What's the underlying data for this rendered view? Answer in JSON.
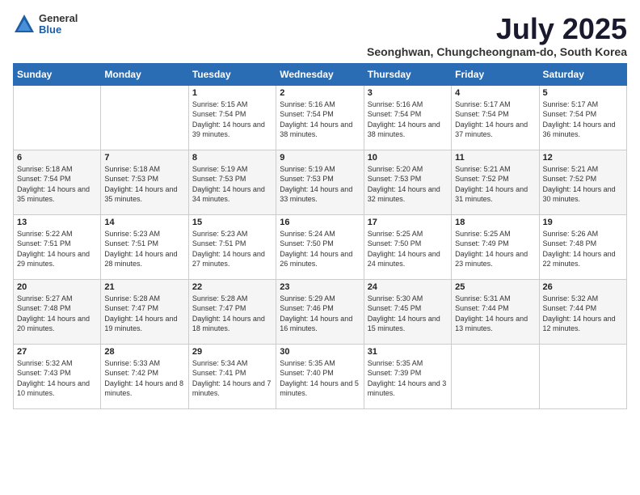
{
  "logo": {
    "general": "General",
    "blue": "Blue"
  },
  "title": "July 2025",
  "location": "Seonghwan, Chungcheongnam-do, South Korea",
  "weekdays": [
    "Sunday",
    "Monday",
    "Tuesday",
    "Wednesday",
    "Thursday",
    "Friday",
    "Saturday"
  ],
  "weeks": [
    [
      {
        "day": "",
        "info": ""
      },
      {
        "day": "",
        "info": ""
      },
      {
        "day": "1",
        "info": "Sunrise: 5:15 AM\nSunset: 7:54 PM\nDaylight: 14 hours and 39 minutes."
      },
      {
        "day": "2",
        "info": "Sunrise: 5:16 AM\nSunset: 7:54 PM\nDaylight: 14 hours and 38 minutes."
      },
      {
        "day": "3",
        "info": "Sunrise: 5:16 AM\nSunset: 7:54 PM\nDaylight: 14 hours and 38 minutes."
      },
      {
        "day": "4",
        "info": "Sunrise: 5:17 AM\nSunset: 7:54 PM\nDaylight: 14 hours and 37 minutes."
      },
      {
        "day": "5",
        "info": "Sunrise: 5:17 AM\nSunset: 7:54 PM\nDaylight: 14 hours and 36 minutes."
      }
    ],
    [
      {
        "day": "6",
        "info": "Sunrise: 5:18 AM\nSunset: 7:54 PM\nDaylight: 14 hours and 35 minutes."
      },
      {
        "day": "7",
        "info": "Sunrise: 5:18 AM\nSunset: 7:53 PM\nDaylight: 14 hours and 35 minutes."
      },
      {
        "day": "8",
        "info": "Sunrise: 5:19 AM\nSunset: 7:53 PM\nDaylight: 14 hours and 34 minutes."
      },
      {
        "day": "9",
        "info": "Sunrise: 5:19 AM\nSunset: 7:53 PM\nDaylight: 14 hours and 33 minutes."
      },
      {
        "day": "10",
        "info": "Sunrise: 5:20 AM\nSunset: 7:53 PM\nDaylight: 14 hours and 32 minutes."
      },
      {
        "day": "11",
        "info": "Sunrise: 5:21 AM\nSunset: 7:52 PM\nDaylight: 14 hours and 31 minutes."
      },
      {
        "day": "12",
        "info": "Sunrise: 5:21 AM\nSunset: 7:52 PM\nDaylight: 14 hours and 30 minutes."
      }
    ],
    [
      {
        "day": "13",
        "info": "Sunrise: 5:22 AM\nSunset: 7:51 PM\nDaylight: 14 hours and 29 minutes."
      },
      {
        "day": "14",
        "info": "Sunrise: 5:23 AM\nSunset: 7:51 PM\nDaylight: 14 hours and 28 minutes."
      },
      {
        "day": "15",
        "info": "Sunrise: 5:23 AM\nSunset: 7:51 PM\nDaylight: 14 hours and 27 minutes."
      },
      {
        "day": "16",
        "info": "Sunrise: 5:24 AM\nSunset: 7:50 PM\nDaylight: 14 hours and 26 minutes."
      },
      {
        "day": "17",
        "info": "Sunrise: 5:25 AM\nSunset: 7:50 PM\nDaylight: 14 hours and 24 minutes."
      },
      {
        "day": "18",
        "info": "Sunrise: 5:25 AM\nSunset: 7:49 PM\nDaylight: 14 hours and 23 minutes."
      },
      {
        "day": "19",
        "info": "Sunrise: 5:26 AM\nSunset: 7:48 PM\nDaylight: 14 hours and 22 minutes."
      }
    ],
    [
      {
        "day": "20",
        "info": "Sunrise: 5:27 AM\nSunset: 7:48 PM\nDaylight: 14 hours and 20 minutes."
      },
      {
        "day": "21",
        "info": "Sunrise: 5:28 AM\nSunset: 7:47 PM\nDaylight: 14 hours and 19 minutes."
      },
      {
        "day": "22",
        "info": "Sunrise: 5:28 AM\nSunset: 7:47 PM\nDaylight: 14 hours and 18 minutes."
      },
      {
        "day": "23",
        "info": "Sunrise: 5:29 AM\nSunset: 7:46 PM\nDaylight: 14 hours and 16 minutes."
      },
      {
        "day": "24",
        "info": "Sunrise: 5:30 AM\nSunset: 7:45 PM\nDaylight: 14 hours and 15 minutes."
      },
      {
        "day": "25",
        "info": "Sunrise: 5:31 AM\nSunset: 7:44 PM\nDaylight: 14 hours and 13 minutes."
      },
      {
        "day": "26",
        "info": "Sunrise: 5:32 AM\nSunset: 7:44 PM\nDaylight: 14 hours and 12 minutes."
      }
    ],
    [
      {
        "day": "27",
        "info": "Sunrise: 5:32 AM\nSunset: 7:43 PM\nDaylight: 14 hours and 10 minutes."
      },
      {
        "day": "28",
        "info": "Sunrise: 5:33 AM\nSunset: 7:42 PM\nDaylight: 14 hours and 8 minutes."
      },
      {
        "day": "29",
        "info": "Sunrise: 5:34 AM\nSunset: 7:41 PM\nDaylight: 14 hours and 7 minutes."
      },
      {
        "day": "30",
        "info": "Sunrise: 5:35 AM\nSunset: 7:40 PM\nDaylight: 14 hours and 5 minutes."
      },
      {
        "day": "31",
        "info": "Sunrise: 5:35 AM\nSunset: 7:39 PM\nDaylight: 14 hours and 3 minutes."
      },
      {
        "day": "",
        "info": ""
      },
      {
        "day": "",
        "info": ""
      }
    ]
  ]
}
